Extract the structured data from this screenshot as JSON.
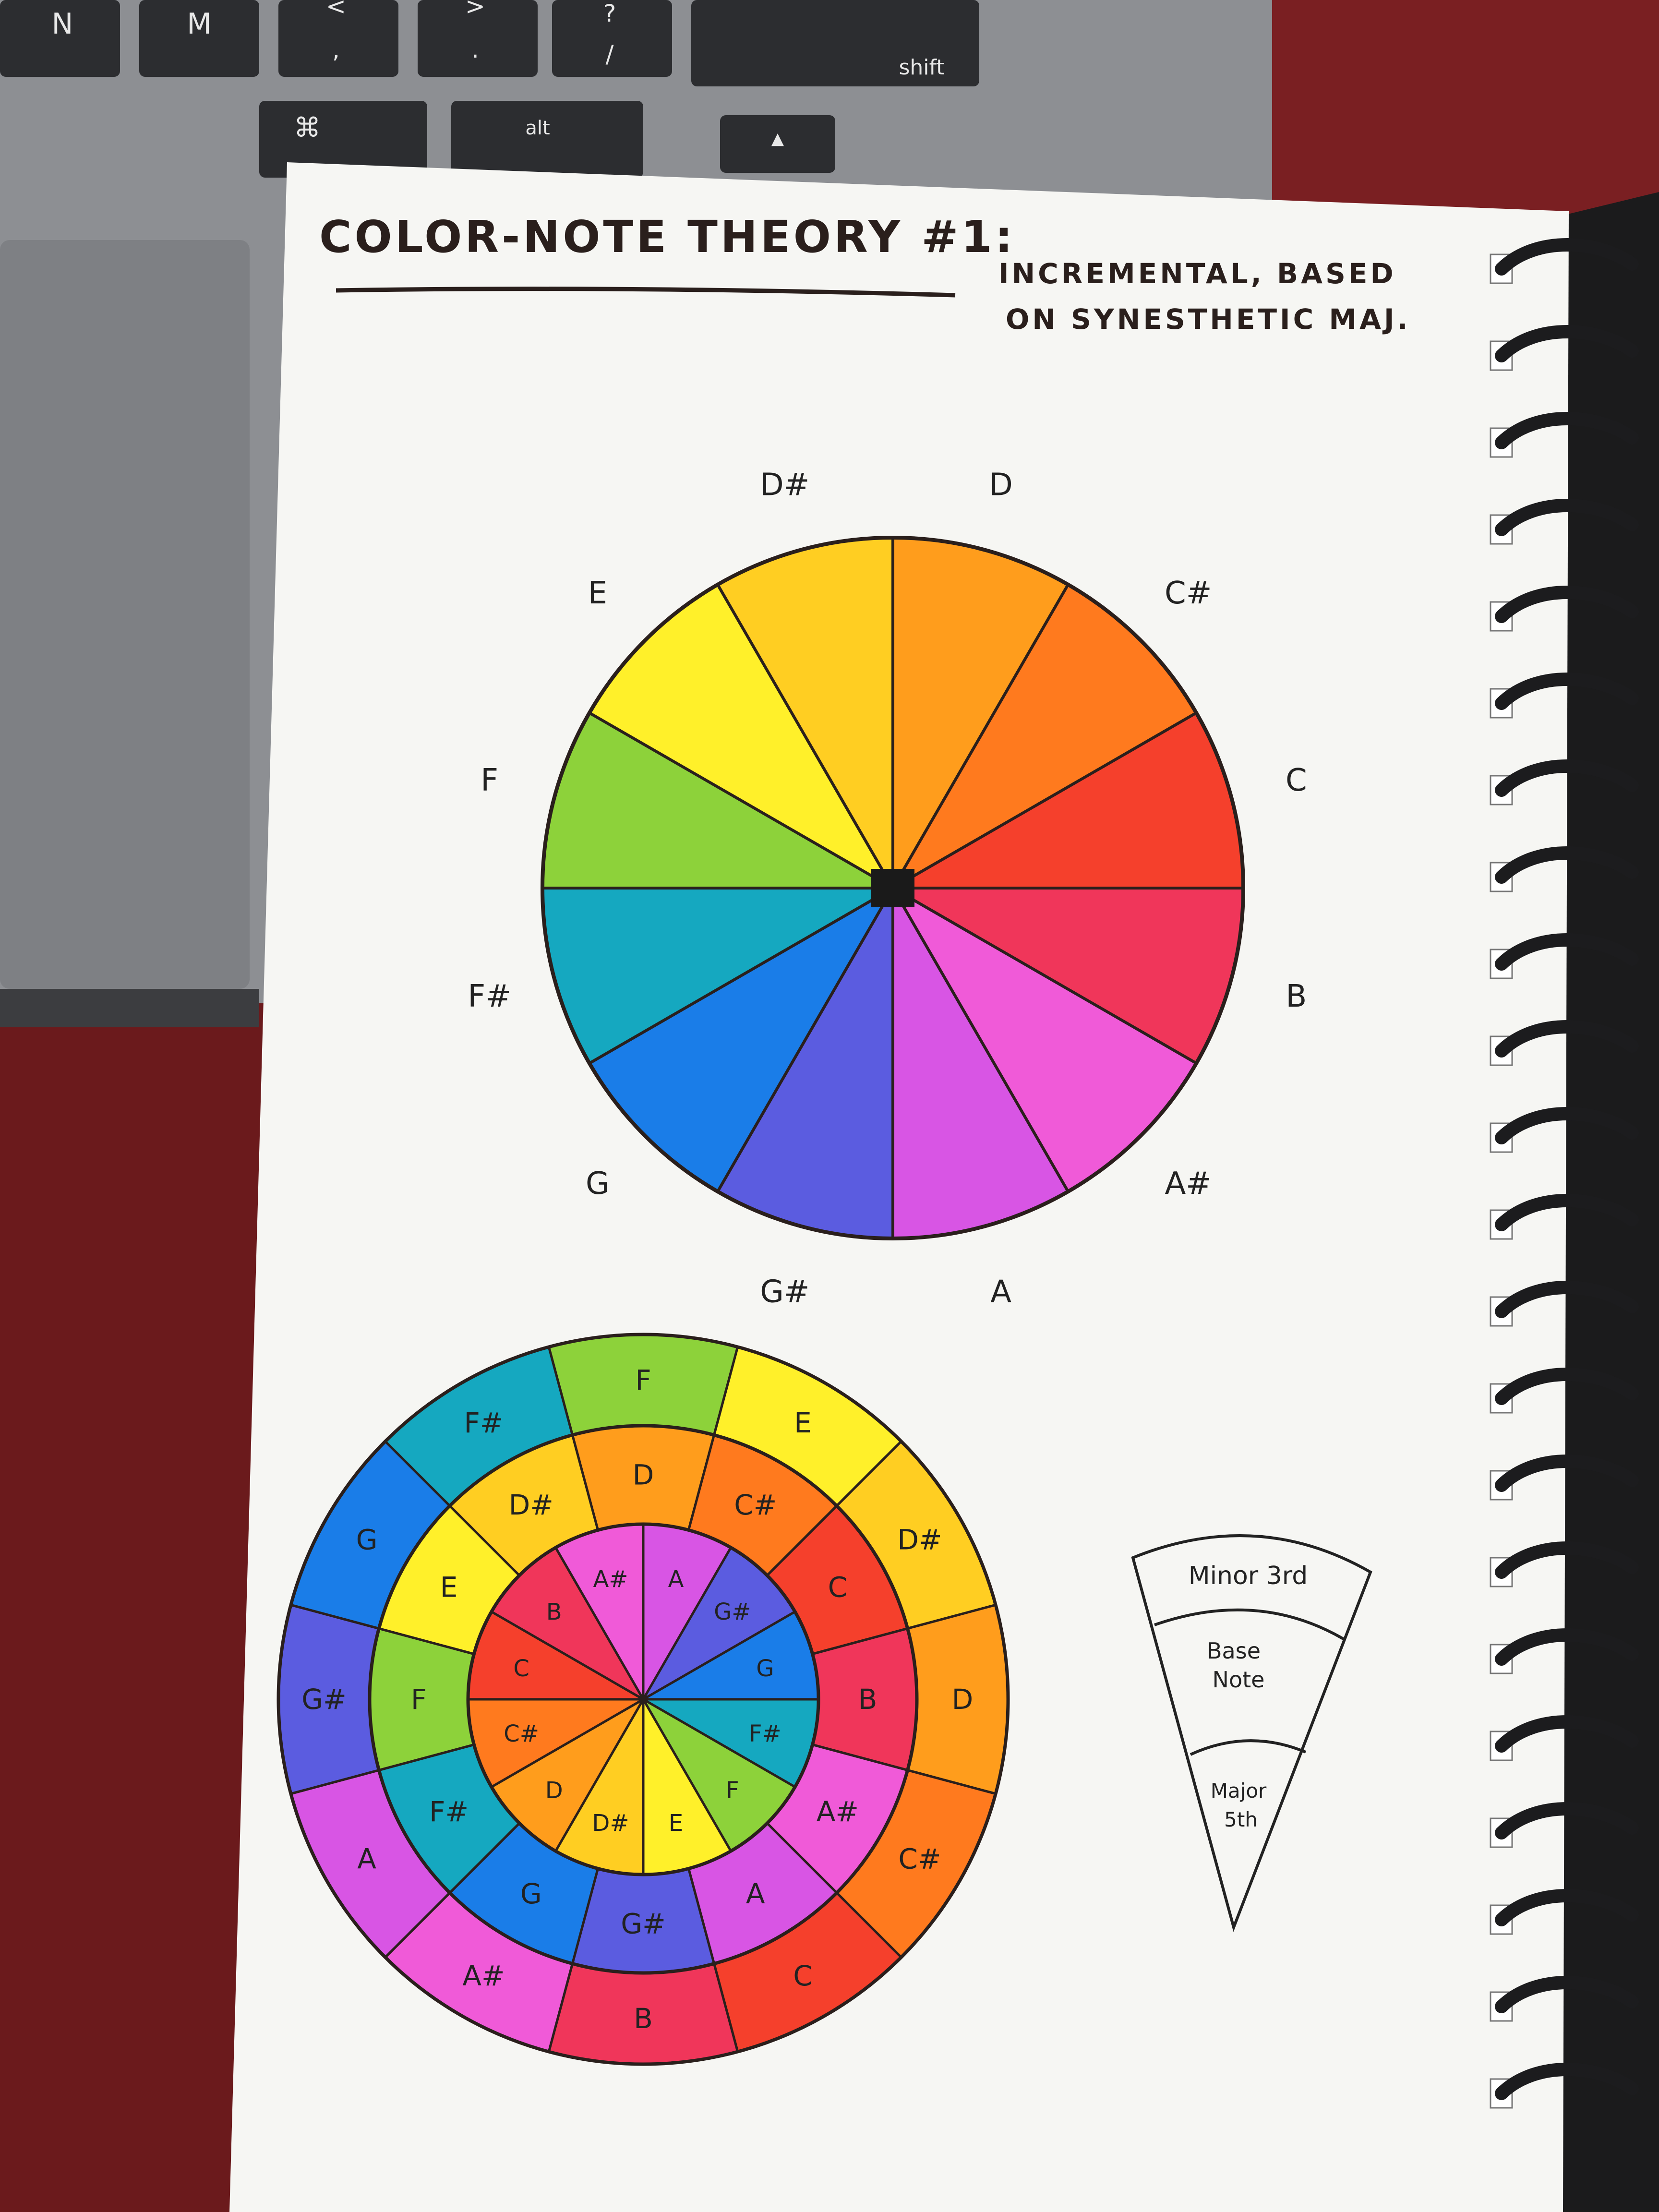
{
  "keyboard": {
    "keys_row1": [
      "N",
      "M",
      "<",
      ",",
      ">",
      ".",
      "?",
      "/",
      "shift"
    ],
    "keys_row2": [
      "⌘",
      "alt",
      "▲"
    ]
  },
  "page": {
    "title": "COLOR-NOTE THEORY #1:",
    "subtitle_line1": "INCREMENTAL, BASED",
    "subtitle_line2": "ON SYNESTHETIC MAJ."
  },
  "wheel1": {
    "segments": [
      {
        "note": "D",
        "color": "#ff9d1c"
      },
      {
        "note": "C#",
        "color": "#ff7a1e"
      },
      {
        "note": "C",
        "color": "#f5402c"
      },
      {
        "note": "B",
        "color": "#f0365a"
      },
      {
        "note": "A#",
        "color": "#f05ad8"
      },
      {
        "note": "A",
        "color": "#d855e4"
      },
      {
        "note": "G#",
        "color": "#5b5ce0"
      },
      {
        "note": "G",
        "color": "#1a7de8"
      },
      {
        "note": "F#",
        "color": "#15a8c0"
      },
      {
        "note": "F",
        "color": "#8dd23a"
      },
      {
        "note": "E",
        "color": "#fff02a"
      },
      {
        "note": "D#",
        "color": "#ffce22"
      }
    ]
  },
  "wheel2": {
    "outer": [
      "F",
      "E",
      "D#",
      "D",
      "C#",
      "C",
      "B",
      "A#",
      "A",
      "G#",
      "G",
      "F#"
    ],
    "middle": [
      "D",
      "C#",
      "C",
      "B",
      "A#",
      "A",
      "G#",
      "G",
      "F#",
      "F",
      "E",
      "D#"
    ],
    "inner": [
      "A",
      "G#",
      "G",
      "F#",
      "F",
      "E",
      "D#",
      "D",
      "C#",
      "C",
      "B",
      "A#"
    ]
  },
  "legend": {
    "top": "Minor 3rd",
    "middle_line1": "Base",
    "middle_line2": "Note",
    "bottom_line1": "Major",
    "bottom_line2": "5th"
  }
}
